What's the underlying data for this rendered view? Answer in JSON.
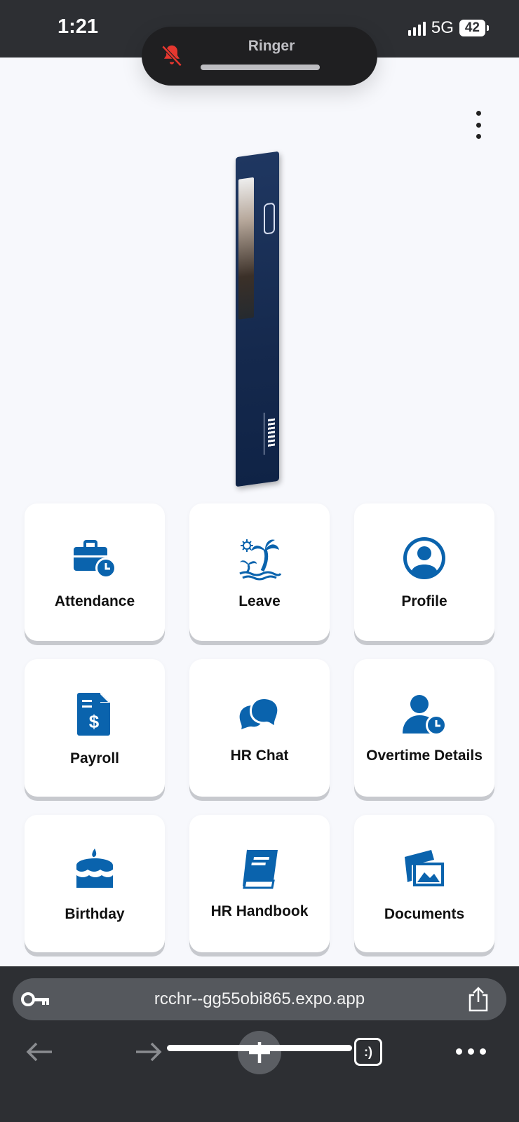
{
  "status_bar": {
    "time": "1:21",
    "network": "5G",
    "battery": "42"
  },
  "ringer": {
    "label": "Ringer"
  },
  "tiles": [
    {
      "label": "Attendance",
      "icon": "briefcase-clock-icon"
    },
    {
      "label": "Leave",
      "icon": "palm-island-icon"
    },
    {
      "label": "Profile",
      "icon": "user-circle-icon"
    },
    {
      "label": "Payroll",
      "icon": "invoice-dollar-icon"
    },
    {
      "label": "HR Chat",
      "icon": "chat-bubbles-icon"
    },
    {
      "label": "Overtime Details",
      "icon": "user-clock-icon"
    },
    {
      "label": "Birthday",
      "icon": "birthday-cake-icon"
    },
    {
      "label": "HR Handbook",
      "icon": "book-icon"
    },
    {
      "label": "Documents",
      "icon": "images-icon"
    }
  ],
  "browser": {
    "url": "rcchr--gg55obi865.expo.app",
    "tabs_glyph": ":)"
  },
  "colors": {
    "accent": "#0a63ad",
    "status_bar": "#2d2f33",
    "background": "#f7f8fc"
  }
}
